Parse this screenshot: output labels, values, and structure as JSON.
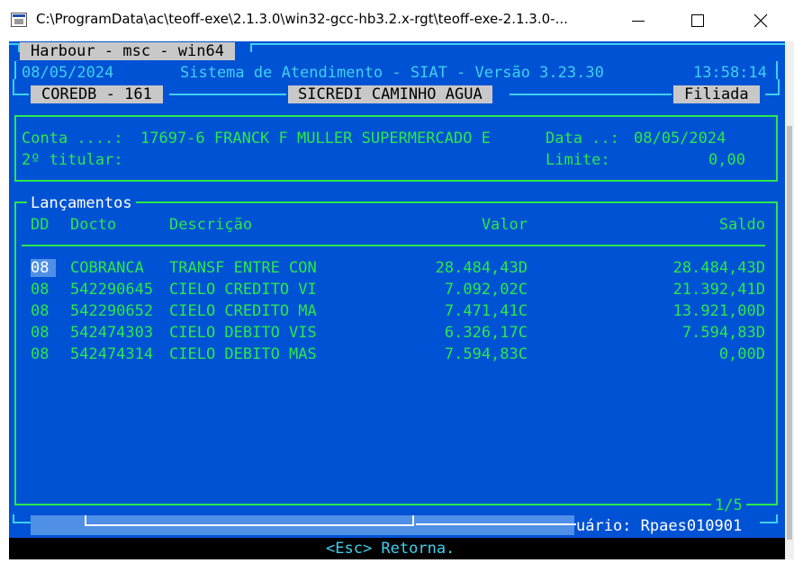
{
  "window": {
    "title": "C:\\ProgramData\\ac\\teoff-exe\\2.1.3.0\\win32-gcc-hb3.2.x-rgt\\teoff-exe-2.1.3.0-..."
  },
  "header": {
    "top_tab": "Harbour - msc - win64",
    "date": "08/05/2024",
    "system_title": "Sistema de Atendimento - SIAT - Versão 3.23.30",
    "time": "13:58:14",
    "coredb": "COREDB - 161",
    "agency": "SICREDI CAMINHO AGUA",
    "branch_type": "Filiada"
  },
  "account": {
    "conta_label": "Conta ....:",
    "conta_value": "17697-6 FRANCK F MULLER SUPERMERCADO E",
    "titular2_label": "2º titular:",
    "data_label": "Data ..:",
    "data_value": "08/05/2024",
    "limite_label": "Limite:",
    "limite_value": "0,00"
  },
  "lancamentos": {
    "title": "Lançamentos",
    "columns": {
      "dd": "DD",
      "docto": "Docto",
      "descricao": "Descrição",
      "valor": "Valor",
      "saldo": "Saldo"
    },
    "rows": [
      {
        "dd": "08",
        "docto": "COBRANCA",
        "descricao": "TRANSF ENTRE CON",
        "valor": "28.484,43D",
        "saldo": "28.484,43D"
      },
      {
        "dd": "08",
        "docto": "542290645",
        "descricao": "CIELO CREDITO VI",
        "valor": "7.092,02C",
        "saldo": "21.392,41D"
      },
      {
        "dd": "08",
        "docto": "542290652",
        "descricao": "CIELO CREDITO MA",
        "valor": "7.471,41C",
        "saldo": "13.921,00D"
      },
      {
        "dd": "08",
        "docto": "542474303",
        "descricao": "CIELO DEBITO VIS",
        "valor": "6.326,17C",
        "saldo": "7.594,83D"
      },
      {
        "dd": "08",
        "docto": "542474314",
        "descricao": "CIELO DEBITO MAS",
        "valor": "7.594,83C",
        "saldo": "0,00D"
      }
    ],
    "page": "1/5"
  },
  "footer": {
    "user": "uário: Rpaes010901",
    "hint": "<Esc> Retorna."
  },
  "colors": {
    "background": "#0052d4",
    "frame": "#3fd0f0",
    "text": "#2be84a",
    "highlight": "#c8c8c8"
  }
}
